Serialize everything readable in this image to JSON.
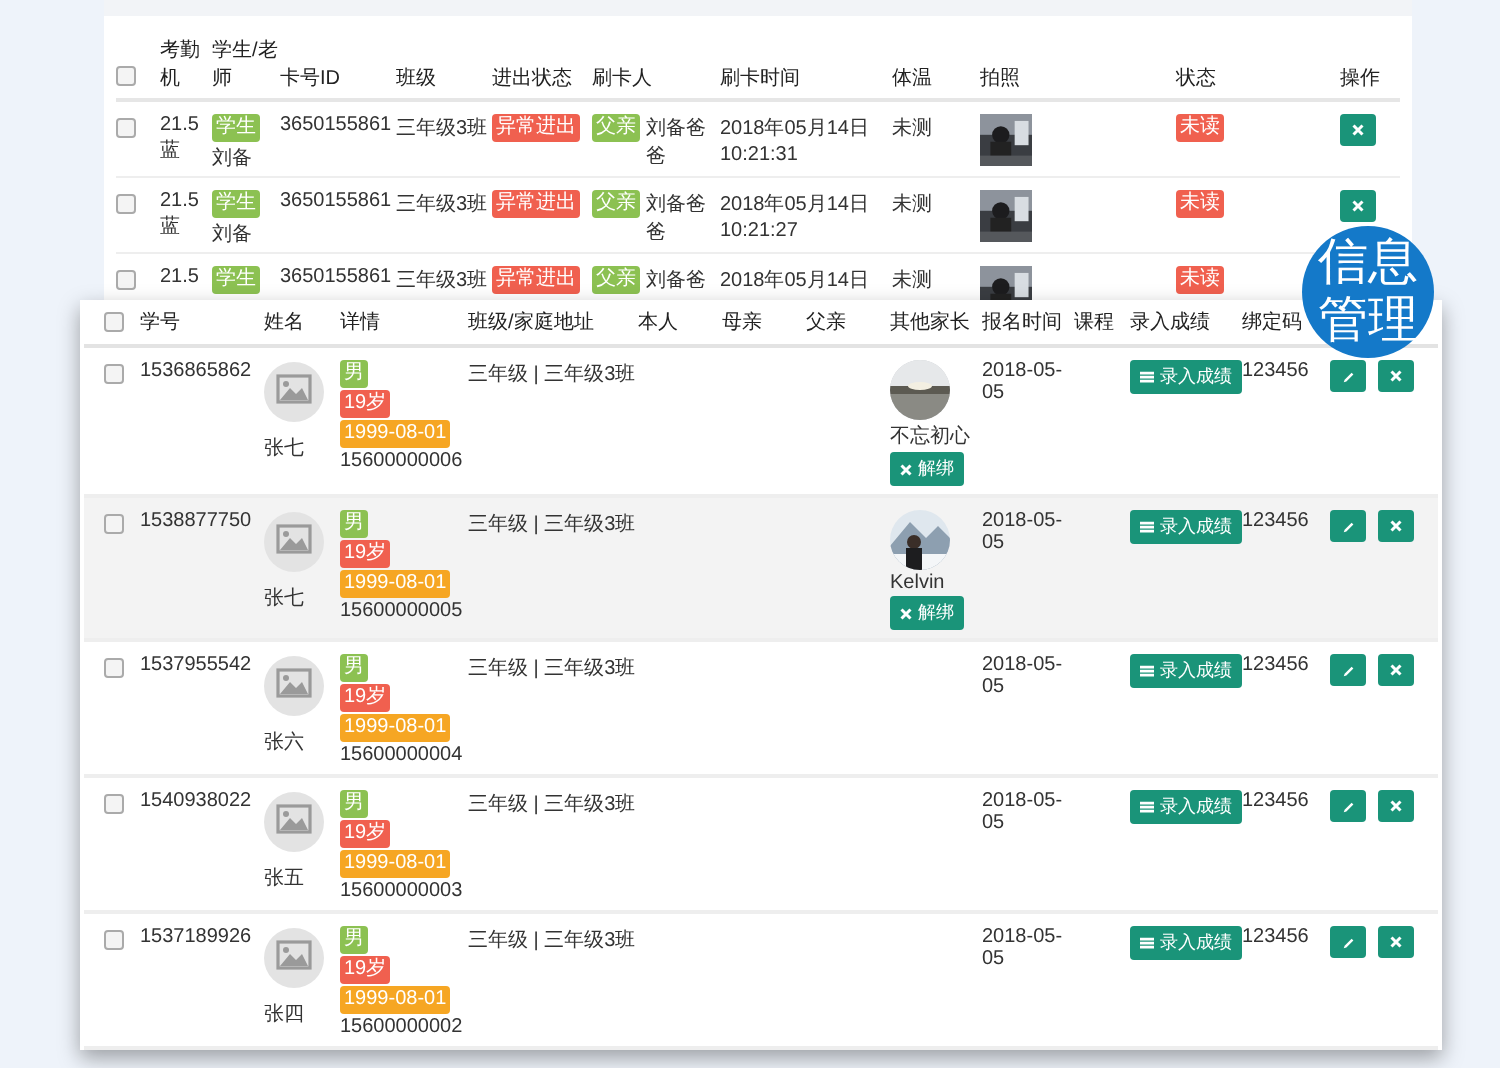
{
  "attendance_table": {
    "select_all": {
      "checked": false
    },
    "columns": [
      "考勤机",
      "学生/老师",
      "卡号ID",
      "班级",
      "进出状态",
      "刷卡人",
      "刷卡时间",
      "体温",
      "拍照",
      "状态",
      "操作"
    ],
    "rows": [
      {
        "checked": false,
        "device": "21.5 蓝",
        "role": "学生",
        "name": "刘备",
        "card_id": "3650155861",
        "class": "三年级3班",
        "status": "异常进出",
        "swiper_role": "父亲",
        "swiper_name": "刘备爸爸",
        "date": "2018年05月14日",
        "time": "10:21:31",
        "temperature": "未测",
        "read_state": "未读",
        "actions": [
          {
            "kind": "delete"
          }
        ]
      },
      {
        "checked": false,
        "device": "21.5 蓝",
        "role": "学生",
        "name": "刘备",
        "card_id": "3650155861",
        "class": "三年级3班",
        "status": "异常进出",
        "swiper_role": "父亲",
        "swiper_name": "刘备爸爸",
        "date": "2018年05月14日",
        "time": "10:21:27",
        "temperature": "未测",
        "read_state": "未读",
        "actions": [
          {
            "kind": "delete"
          }
        ]
      },
      {
        "checked": false,
        "device": "21.5",
        "role": "学生",
        "card_id": "3650155861",
        "class": "三年级3班",
        "status": "异常进出",
        "swiper_role": "父亲",
        "swiper_name": "刘备爸",
        "date": "2018年05月14日",
        "temperature": "未测",
        "read_state": "未读"
      }
    ]
  },
  "student_table": {
    "select_all": {
      "checked": false
    },
    "columns": [
      "学号",
      "姓名",
      "详情",
      "班级/家庭地址",
      "本人",
      "母亲",
      "父亲",
      "其他家长",
      "报名时间",
      "课程",
      "录入成绩",
      "绑定码"
    ],
    "rows": [
      {
        "checked": false,
        "selected": false,
        "id": "1536865862",
        "name": "张七",
        "gender": "男",
        "age": "19岁",
        "birthday": "1999-08-01",
        "phone": "15600000006",
        "address": "三年级 | 三年级3班",
        "other_parent": {
          "name": "不忘初心",
          "unbind": "解绑"
        },
        "enroll_date": "2018-05-05",
        "grade_button": "录入成绩",
        "code": "123456"
      },
      {
        "checked": false,
        "selected": true,
        "id": "1538877750",
        "name": "张七",
        "gender": "男",
        "age": "19岁",
        "birthday": "1999-08-01",
        "phone": "15600000005",
        "address": "三年级 | 三年级3班",
        "other_parent": {
          "name": "Kelvin",
          "unbind": "解绑"
        },
        "enroll_date": "2018-05-05",
        "grade_button": "录入成绩",
        "code": "123456"
      },
      {
        "checked": false,
        "selected": false,
        "id": "1537955542",
        "name": "张六",
        "gender": "男",
        "age": "19岁",
        "birthday": "1999-08-01",
        "phone": "15600000004",
        "address": "三年级 | 三年级3班",
        "enroll_date": "2018-05-05",
        "grade_button": "录入成绩",
        "code": "123456"
      },
      {
        "checked": false,
        "selected": false,
        "id": "1540938022",
        "name": "张五",
        "gender": "男",
        "age": "19岁",
        "birthday": "1999-08-01",
        "phone": "15600000003",
        "address": "三年级 | 三年级3班",
        "enroll_date": "2018-05-05",
        "grade_button": "录入成绩",
        "code": "123456"
      },
      {
        "checked": false,
        "selected": false,
        "id": "1537189926",
        "name": "张四",
        "gender": "男",
        "age": "19岁",
        "birthday": "1999-08-01",
        "phone": "15600000002",
        "address": "三年级 | 三年级3班",
        "enroll_date": "2018-05-05",
        "grade_button": "录入成绩",
        "code": "123456"
      }
    ]
  },
  "badge": {
    "title": "信息管理"
  }
}
